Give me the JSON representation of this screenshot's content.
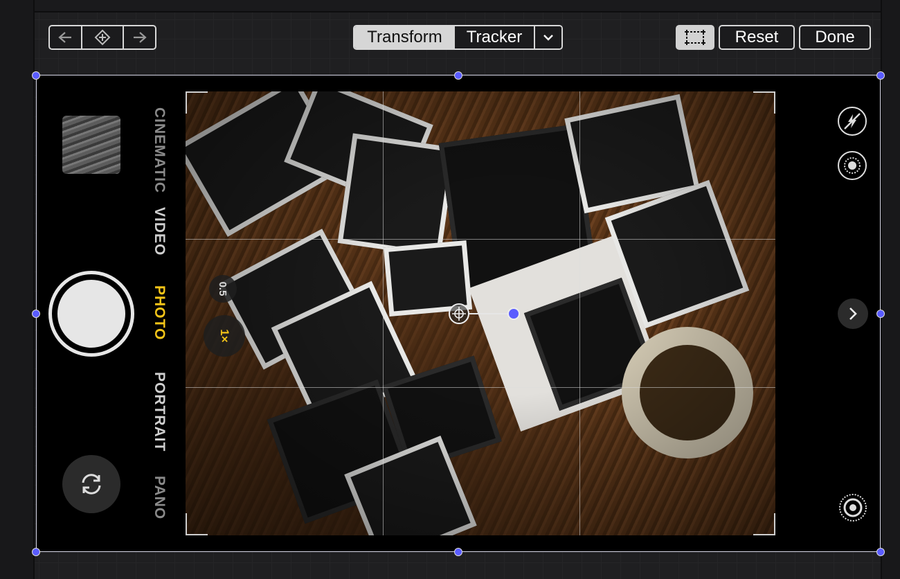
{
  "toolbar": {
    "prev_keyframe_label": "previous keyframe",
    "add_keyframe_label": "add keyframe",
    "next_keyframe_label": "next keyframe",
    "mode_transform": "Transform",
    "mode_tracker": "Tracker",
    "mode_more": "⌄",
    "reset_label": "Reset",
    "done_label": "Done"
  },
  "camera": {
    "modes": [
      "CINEMATIC",
      "VIDEO",
      "PHOTO",
      "PORTRAIT",
      "PANO"
    ],
    "active_mode": "PHOTO",
    "zoom_options": [
      "0.5",
      "1×"
    ],
    "active_zoom": "1×"
  },
  "colors": {
    "active_mode": "#f5c518",
    "handle": "#5a5cff",
    "bounding_box": "#d8d8e8"
  },
  "icons": {
    "prev_keyframe": "arrow-left-icon",
    "add_keyframe": "keyframe-diamond-icon",
    "next_keyframe": "arrow-right-icon",
    "crop": "crop-icon",
    "flash_off": "flash-off-icon",
    "live_photo": "live-photo-icon",
    "expand": "chevron-right-icon",
    "flip": "camera-flip-icon",
    "macro": "target-icon"
  }
}
